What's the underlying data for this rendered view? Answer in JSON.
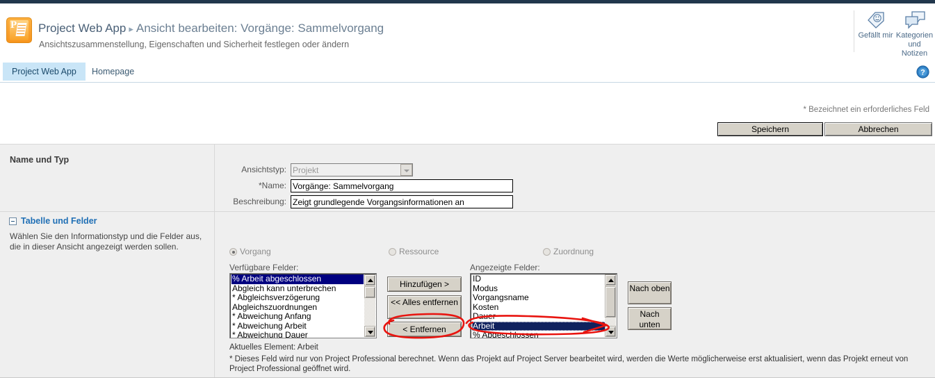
{
  "header": {
    "app_title": "Project Web App",
    "separator": "▸",
    "page_title": "Ansicht bearbeiten: Vorgänge: Sammelvorgang",
    "subtitle": "Ansichtszusammenstellung, Eigenschaften und Sicherheit festlegen oder ändern",
    "logo_letter": "P",
    "tools": [
      {
        "icon": "tag-icon",
        "label": "Gefällt mir"
      },
      {
        "icon": "notes-icon",
        "label": "Kategorien und Notizen"
      }
    ]
  },
  "nav": {
    "tabs": [
      {
        "label": "Project Web App",
        "active": true
      },
      {
        "label": "Homepage",
        "active": false
      }
    ],
    "help_icon": "help-icon",
    "help_glyph": "?"
  },
  "actions": {
    "required_note": "* Bezeichnet ein erforderliches Feld",
    "save_label": "Speichern",
    "cancel_label": "Abbrechen"
  },
  "name_section": {
    "title": "Name und Typ",
    "fields": {
      "view_type_label": "Ansichtstyp:",
      "view_type_value": "Projekt",
      "name_label": "Name:",
      "name_required_mark": "*",
      "name_value": "Vorgänge: Sammelvorgang",
      "description_label": "Beschreibung:",
      "description_value": "Zeigt grundlegende Vorgangsinformationen an"
    }
  },
  "fields_section": {
    "title": "Tabelle und Felder",
    "description": "Wählen Sie den Informationstyp und die Felder aus, die in dieser Ansicht angezeigt werden sollen.",
    "radios": [
      {
        "label": "Vorgang",
        "selected": true
      },
      {
        "label": "Ressource",
        "selected": false
      },
      {
        "label": "Zuordnung",
        "selected": false
      }
    ],
    "available_label": "Verfügbare Felder:",
    "displayed_label": "Angezeigte Felder:",
    "available_fields": [
      "% Arbeit abgeschlossen",
      "Abgleich kann unterbrechen",
      "* Abgleichsverzögerung",
      "Abgleichszuordnungen",
      "* Abweichung Anfang",
      "* Abweichung Arbeit",
      "* Abweichung Dauer"
    ],
    "available_selected_index": 0,
    "displayed_fields": [
      "ID",
      "Modus",
      "Vorgangsname",
      "Kosten",
      "Dauer",
      "Arbeit",
      "% Abgeschlossen"
    ],
    "displayed_selected_index": 5,
    "buttons": {
      "add": "Hinzufügen >",
      "remove_all": "<< Alles entfernen",
      "remove": "< Entfernen",
      "move_up": "Nach oben",
      "move_down": "Nach unten"
    },
    "current_element": "Aktuelles Element: Arbeit",
    "footnote": "* Dieses Feld wird nur von Project Professional berechnet. Wenn das Projekt auf Project Server bearbeitet wird, werden die Werte möglicherweise erst aktualisiert, wenn das Projekt erneut von Project Professional geöffnet wird."
  },
  "annotations": {
    "color": "#e8140f",
    "marks": [
      {
        "name": "ellipse-remove-button",
        "target": "< Entfernen"
      },
      {
        "name": "ellipse-arbeit-item",
        "target": "Arbeit"
      }
    ]
  }
}
